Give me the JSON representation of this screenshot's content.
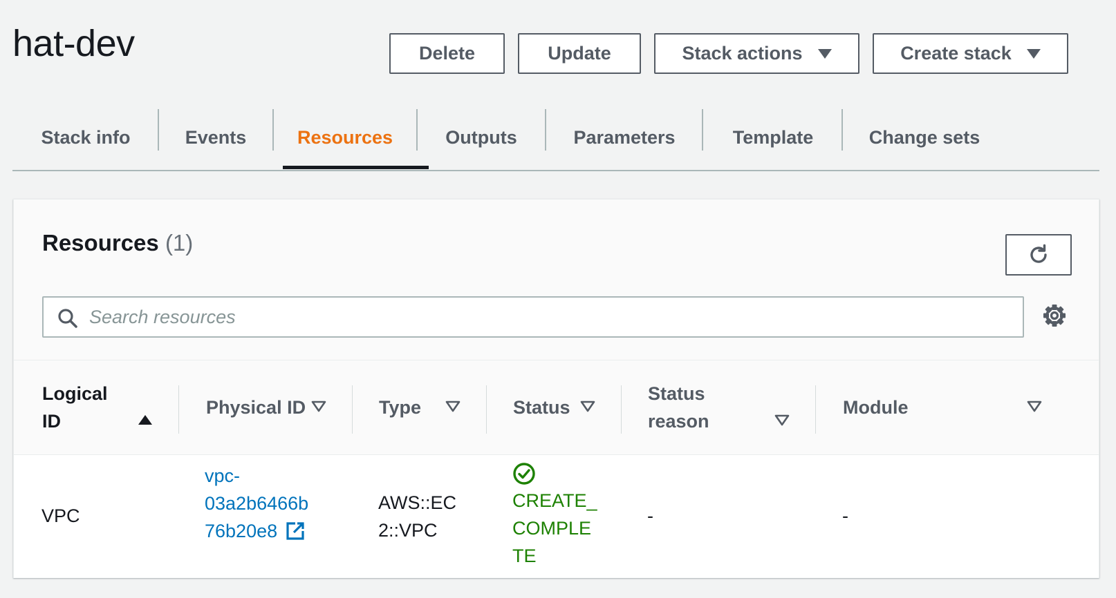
{
  "header": {
    "title": "hat-dev",
    "buttons": {
      "delete": "Delete",
      "update": "Update",
      "stack_actions": "Stack actions",
      "create_stack": "Create stack"
    }
  },
  "tabs": [
    {
      "label": "Stack info",
      "active": false
    },
    {
      "label": "Events",
      "active": false
    },
    {
      "label": "Resources",
      "active": true
    },
    {
      "label": "Outputs",
      "active": false
    },
    {
      "label": "Parameters",
      "active": false
    },
    {
      "label": "Template",
      "active": false
    },
    {
      "label": "Change sets",
      "active": false
    }
  ],
  "panel": {
    "title": "Resources",
    "count": "(1)",
    "search_placeholder": "Search resources"
  },
  "table": {
    "columns": [
      {
        "line1": "Logical",
        "line2": "ID",
        "sort": "ascending"
      },
      {
        "label": "Physical ID",
        "sort": "none"
      },
      {
        "label": "Type",
        "sort": "none"
      },
      {
        "label": "Status",
        "sort": "none"
      },
      {
        "line1": "Status",
        "line2": "reason",
        "sort": "none"
      },
      {
        "label": "Module",
        "sort": "none"
      }
    ],
    "rows": [
      {
        "logical_id": "VPC",
        "physical_id_lines": [
          "vpc-",
          "03a2b6466b",
          "76b20e8"
        ],
        "type_lines": [
          "AWS::EC",
          "2::VPC"
        ],
        "status_lines": [
          "CREATE_",
          "COMPLE",
          "TE"
        ],
        "status_reason": "-",
        "module": "-"
      }
    ]
  },
  "colors": {
    "accent_active_tab": "#ec7211",
    "link": "#0073bb",
    "success": "#1d8102",
    "text_dark": "#16191f",
    "text_muted": "#545b64"
  },
  "icons": {
    "refresh": "refresh-icon",
    "search": "search-icon",
    "settings": "gear-icon",
    "external_link": "external-link-icon",
    "status_success": "check-circle-icon",
    "dropdown": "caret-down-icon",
    "sort_asc": "sort-ascending-icon",
    "sort_none": "sort-none-icon"
  }
}
